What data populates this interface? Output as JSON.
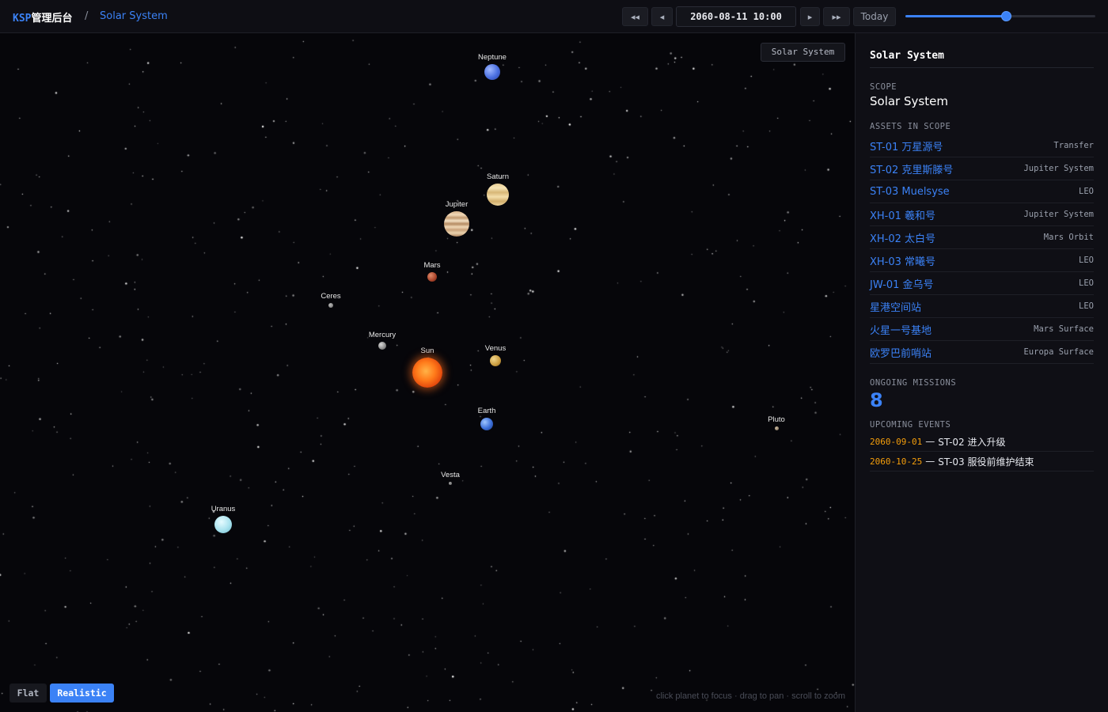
{
  "header": {
    "brand_prefix": "KSP",
    "brand_suffix": "管理后台",
    "breadcrumb_separator": "/",
    "breadcrumb_page": "Solar System"
  },
  "timebar": {
    "rewind_fast_glyph": "◂◂",
    "step_back_glyph": "◂",
    "datetime": "2060-08-11 10:00",
    "step_forward_glyph": "▸",
    "forward_fast_glyph": "▸▸",
    "today_label": "Today",
    "slider_position": 0.53
  },
  "space": {
    "scope_badge": "Solar System",
    "view_modes": [
      "Flat",
      "Realistic"
    ],
    "active_view": "Realistic",
    "hint": "click planet to focus · drag to pan · scroll to zoom",
    "bodies": [
      {
        "key": "sun",
        "label": "Sun",
        "icon": "sun-icon"
      },
      {
        "key": "mercury",
        "label": "Mercury",
        "icon": "planet-icon"
      },
      {
        "key": "venus",
        "label": "Venus",
        "icon": "planet-icon"
      },
      {
        "key": "earth",
        "label": "Earth",
        "icon": "planet-icon"
      },
      {
        "key": "mars",
        "label": "Mars",
        "icon": "planet-icon"
      },
      {
        "key": "ceres",
        "label": "Ceres",
        "icon": "dwarf-planet-icon"
      },
      {
        "key": "vesta",
        "label": "Vesta",
        "icon": "asteroid-icon"
      },
      {
        "key": "jupiter",
        "label": "Jupiter",
        "icon": "planet-icon"
      },
      {
        "key": "saturn",
        "label": "Saturn",
        "icon": "planet-icon"
      },
      {
        "key": "uranus",
        "label": "Uranus",
        "icon": "planet-icon"
      },
      {
        "key": "neptune",
        "label": "Neptune",
        "icon": "planet-icon"
      },
      {
        "key": "pluto",
        "label": "Pluto",
        "icon": "dwarf-planet-icon"
      }
    ]
  },
  "panel": {
    "title": "Solar System",
    "scope_label": "SCOPE",
    "scope_value": "Solar System",
    "assets_label": "ASSETS IN SCOPE",
    "assets": [
      {
        "name": "ST-01 万星源号",
        "location": "Transfer"
      },
      {
        "name": "ST-02 克里斯滕号",
        "location": "Jupiter System"
      },
      {
        "name": "ST-03 Muelsyse",
        "location": "LEO"
      },
      {
        "name": "XH-01 羲和号",
        "location": "Jupiter System"
      },
      {
        "name": "XH-02 太白号",
        "location": "Mars Orbit"
      },
      {
        "name": "XH-03 常曦号",
        "location": "LEO"
      },
      {
        "name": "JW-01 金乌号",
        "location": "LEO"
      },
      {
        "name": "星港空间站",
        "location": "LEO"
      },
      {
        "name": "火星一号基地",
        "location": "Mars Surface"
      },
      {
        "name": "欧罗巴前哨站",
        "location": "Europa Surface"
      }
    ],
    "missions_label": "ONGOING MISSIONS",
    "missions_count": "8",
    "events_label": "UPCOMING EVENTS",
    "events": [
      {
        "date": "2060-09-01",
        "separator": "—",
        "text": "ST-02 进入升级"
      },
      {
        "date": "2060-10-25",
        "separator": "—",
        "text": "ST-03 服役前维护结束"
      }
    ]
  },
  "colors": {
    "accent": "#3b82f6",
    "event_date": "#f59e0b",
    "background": "#06060a"
  }
}
